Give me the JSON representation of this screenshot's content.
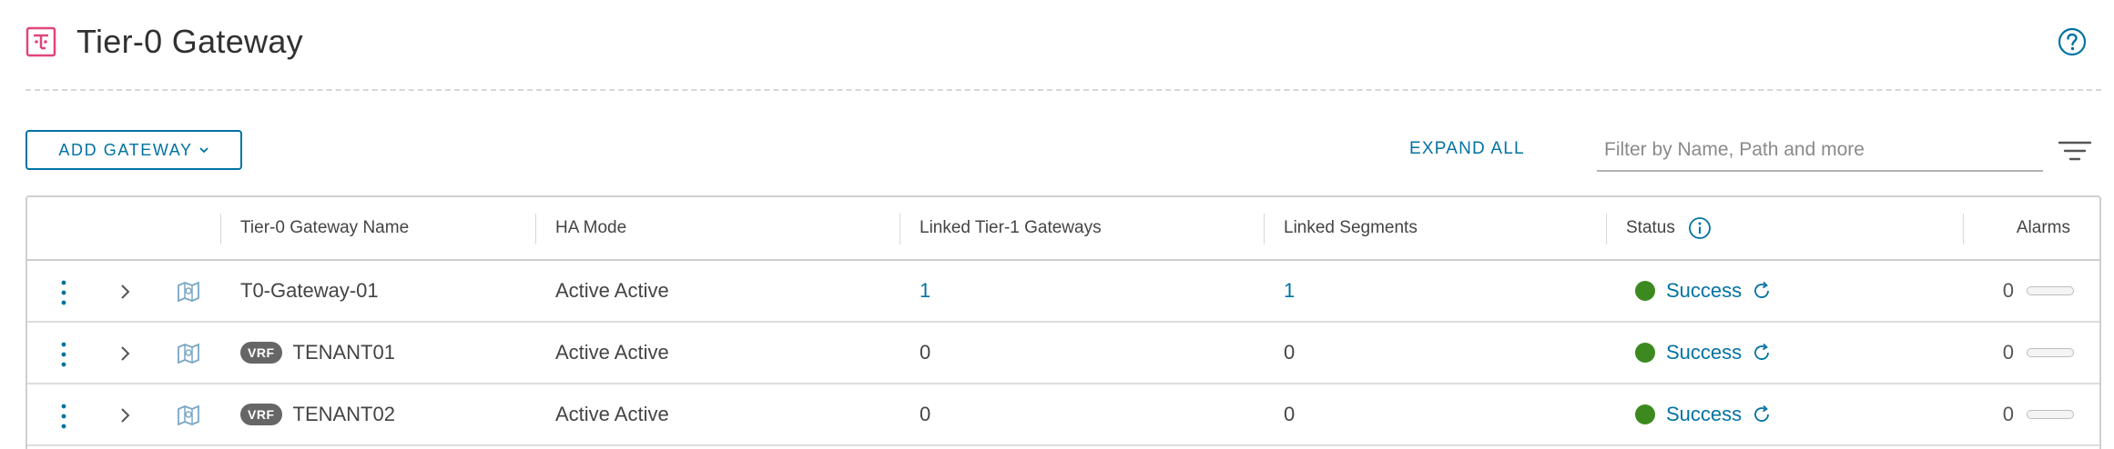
{
  "header": {
    "title": "Tier-0 Gateway",
    "title_icon": "tier0-gateway-icon",
    "help_icon": "help-icon"
  },
  "toolbar": {
    "add_gateway_label": "ADD GATEWAY",
    "expand_all_label": "EXPAND ALL",
    "filter_placeholder": "Filter by Name, Path and more"
  },
  "table": {
    "columns": {
      "name": "Tier-0 Gateway Name",
      "ha_mode": "HA Mode",
      "linked_t1": "Linked Tier-1 Gateways",
      "linked_segments": "Linked Segments",
      "status": "Status",
      "alarms": "Alarms"
    },
    "rows": [
      {
        "vrf_badge": "",
        "name": "T0-Gateway-01",
        "ha_mode": "Active Active",
        "linked_t1": "1",
        "linked_segments": "1",
        "status": "Success",
        "alarms": "0"
      },
      {
        "vrf_badge": "VRF",
        "name": "TENANT01",
        "ha_mode": "Active Active",
        "linked_t1": "0",
        "linked_segments": "0",
        "status": "Success",
        "alarms": "0"
      },
      {
        "vrf_badge": "VRF",
        "name": "TENANT02",
        "ha_mode": "Active Active",
        "linked_t1": "0",
        "linked_segments": "0",
        "status": "Success",
        "alarms": "0"
      }
    ]
  },
  "colors": {
    "accent": "#0072a3",
    "success": "#3c8a1f",
    "title_icon": "#e0457b",
    "vrf_badge": "#666666"
  }
}
